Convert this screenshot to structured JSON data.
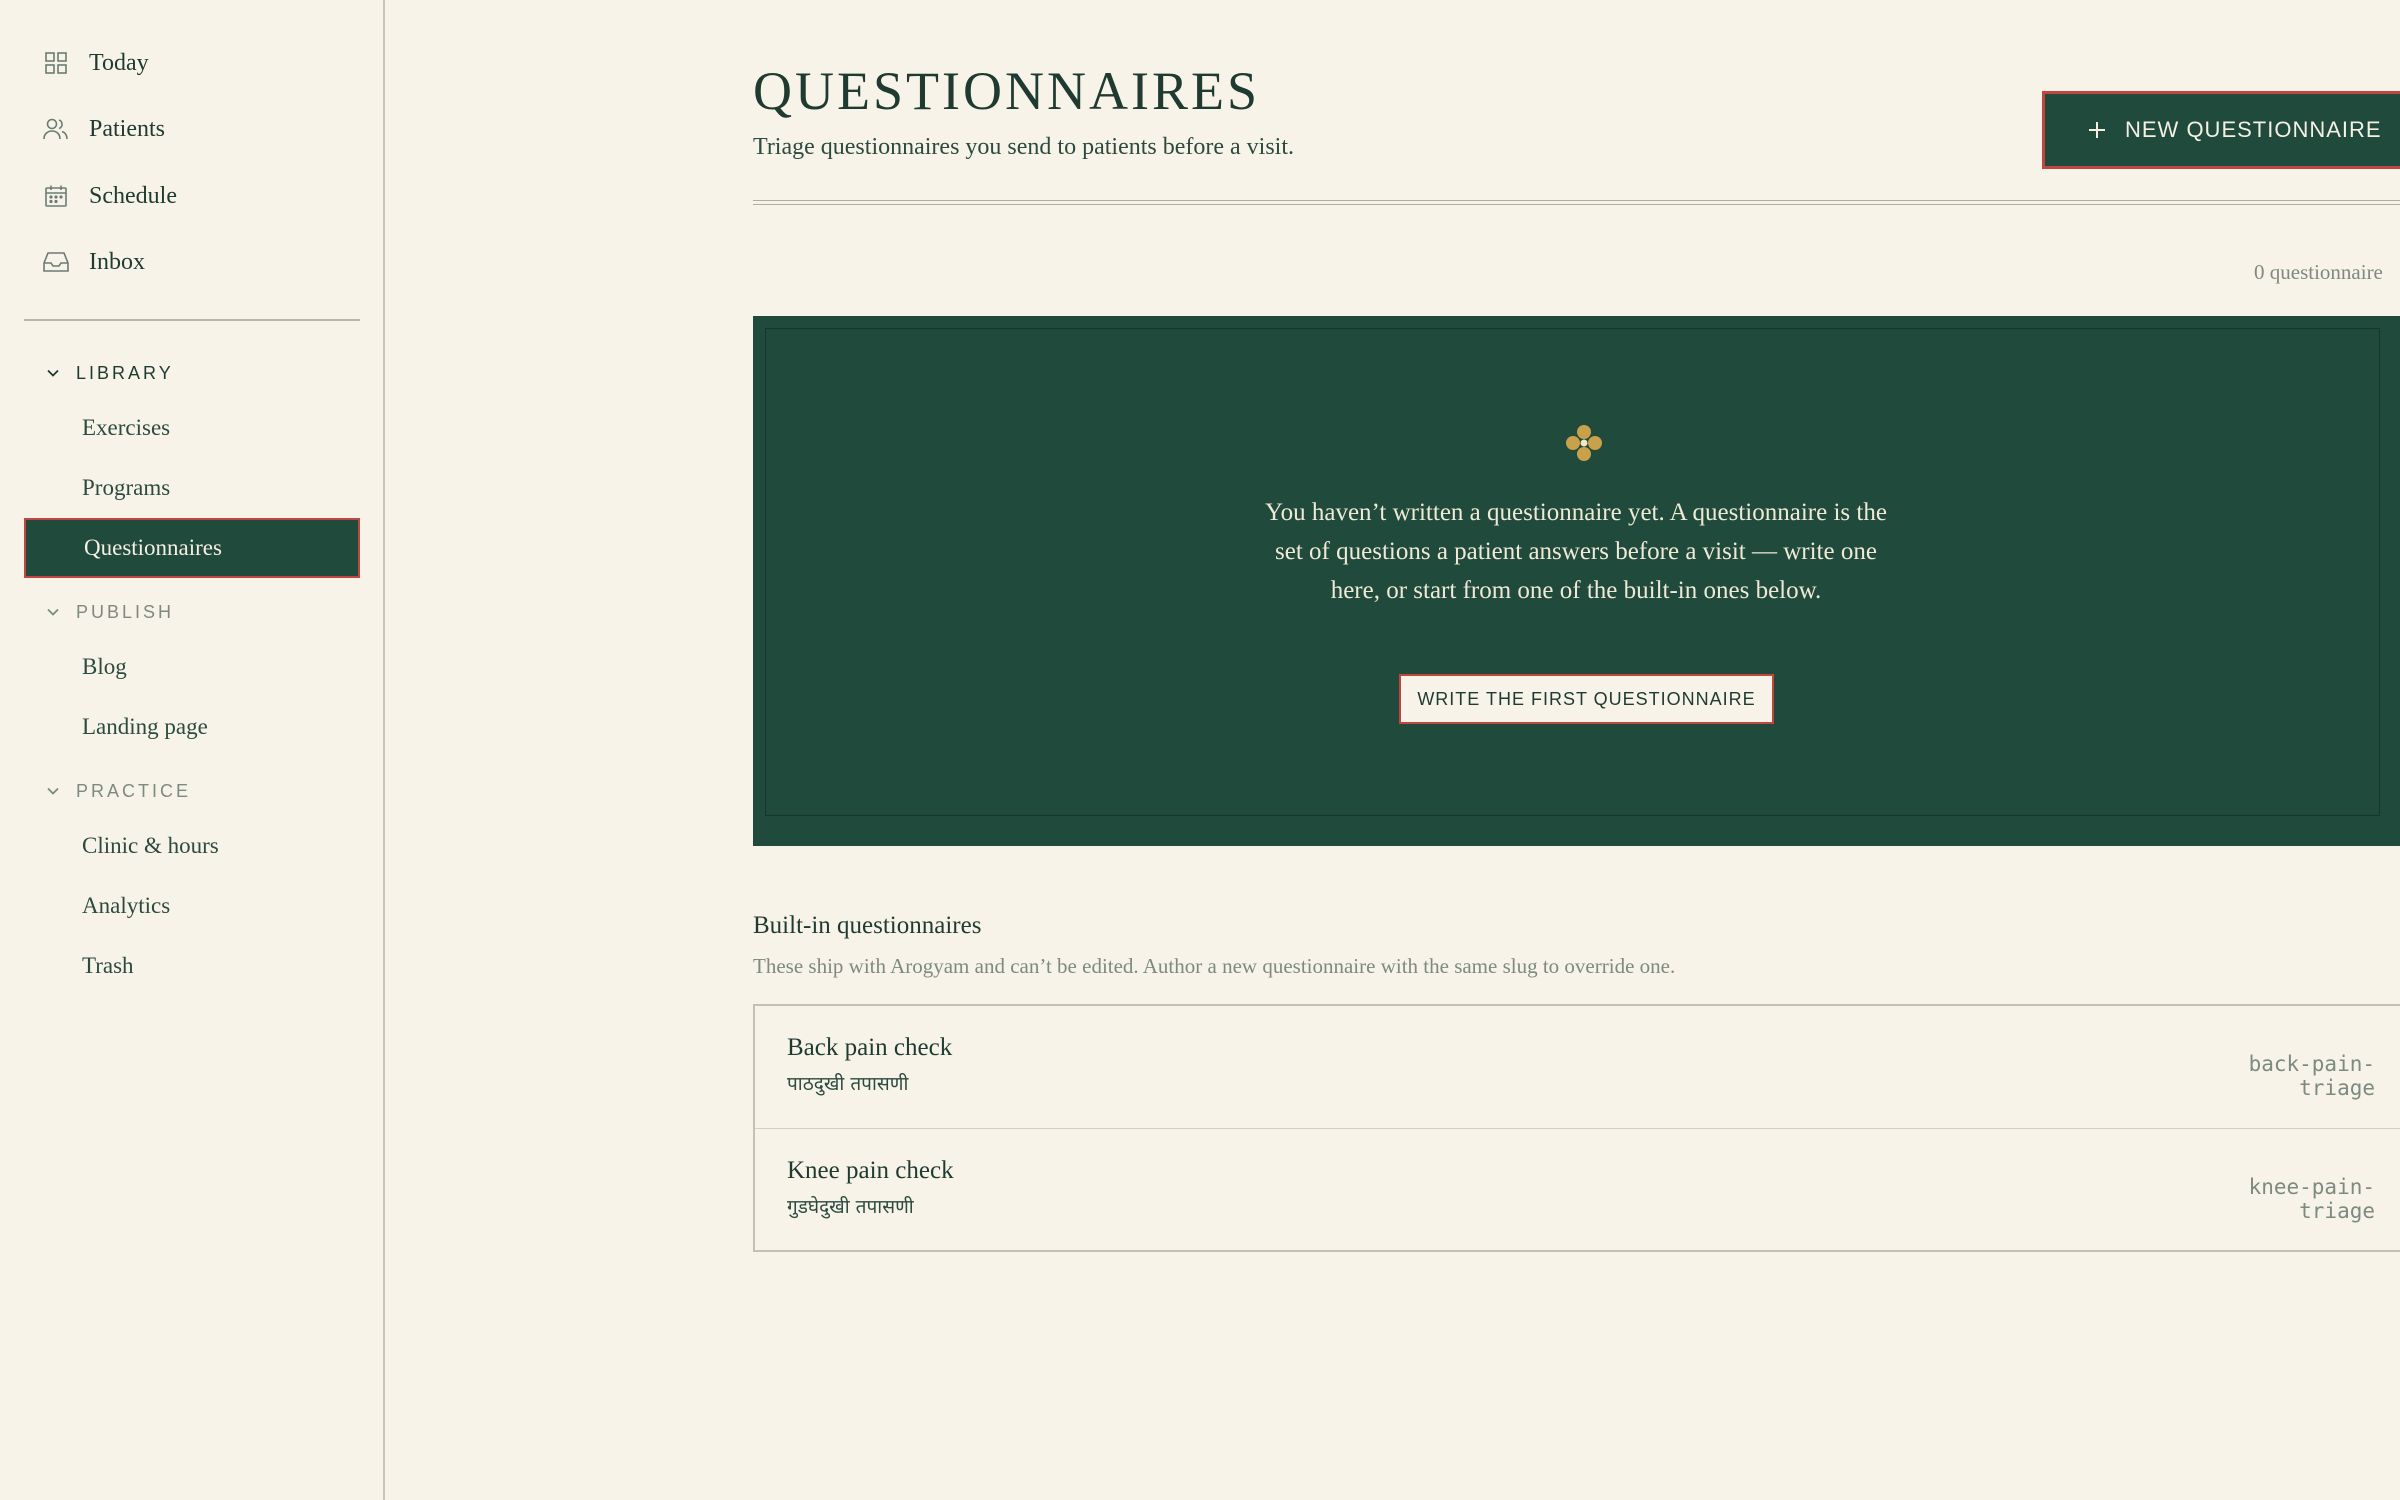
{
  "sidebar": {
    "nav": [
      {
        "label": "Today",
        "icon": "grid-icon"
      },
      {
        "label": "Patients",
        "icon": "users-icon"
      },
      {
        "label": "Schedule",
        "icon": "calendar-icon"
      },
      {
        "label": "Inbox",
        "icon": "inbox-icon"
      }
    ],
    "sections": [
      {
        "label": "LIBRARY",
        "expanded": true,
        "items": [
          "Exercises",
          "Programs",
          "Questionnaires"
        ]
      },
      {
        "label": "PUBLISH",
        "expanded": true,
        "items": [
          "Blog",
          "Landing page"
        ]
      },
      {
        "label": "PRACTICE",
        "expanded": true,
        "items": [
          "Clinic & hours",
          "Analytics",
          "Trash"
        ]
      }
    ],
    "selected_item": "Questionnaires"
  },
  "header": {
    "title": "QUESTIONNAIRES",
    "subtitle": "Triage questionnaires you send to patients before a visit.",
    "new_button_label": "NEW QUESTIONNAIRE"
  },
  "count_label": "0 questionnaire",
  "empty_state": {
    "message": "You haven’t written a questionnaire yet. A questionnaire is the set of questions a patient answers before a visit — write one here, or start from one of the built-in ones below.",
    "button_label": "WRITE THE FIRST QUESTIONNAIRE"
  },
  "builtin": {
    "title": "Built-in questionnaires",
    "subtitle": "These ship with Arogyam and can’t be edited. Author a new questionnaire with the same slug to override one.",
    "items": [
      {
        "name": "Back pain check",
        "alt_name": "पाठदुखी तपासणी",
        "slug": "back-pain-triage"
      },
      {
        "name": "Knee pain check",
        "alt_name": "गुडघेदुखी तपासणी",
        "slug": "knee-pain-triage"
      }
    ]
  },
  "colors": {
    "background": "#f7f3e8",
    "primary": "#1f4a3c",
    "accent_border": "#c1463f",
    "gold": "#c9a14a",
    "muted_text": "#7d8a80"
  }
}
